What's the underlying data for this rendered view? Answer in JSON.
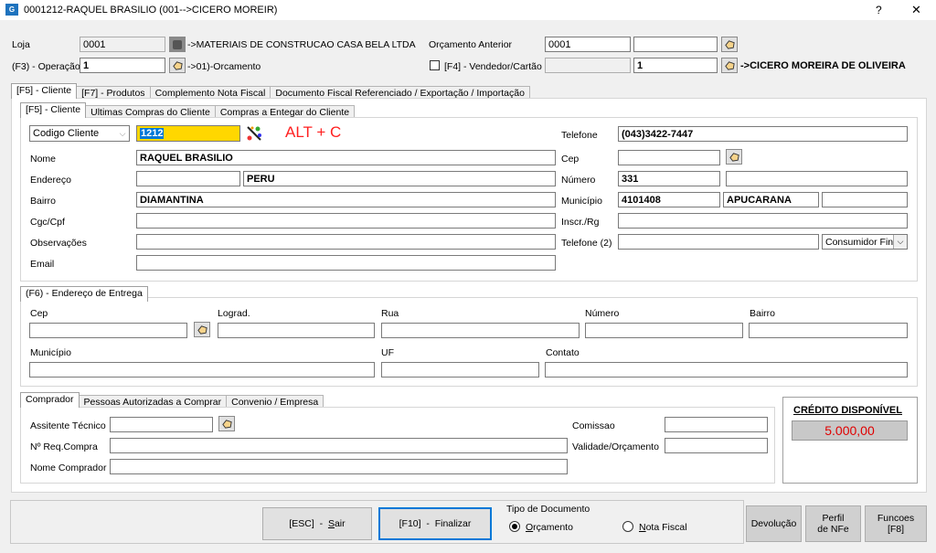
{
  "window": {
    "title": "0001212-RAQUEL BRASILIO   (001-->CICERO MOREIR)",
    "help": "?",
    "close": "✕"
  },
  "header": {
    "loja_label": "Loja",
    "loja_value": "0001",
    "loja_desc": "->MATERIAIS DE CONSTRUCAO CASA BELA LTDA",
    "operacao_label": "(F3) - Operação",
    "operacao_value": "1",
    "operacao_desc": "->01)-Orcamento",
    "orc_anterior_label": "Orçamento Anterior",
    "orc_anterior_value": "0001",
    "orc_anterior_extra": "",
    "vendedor_label": "[F4] - Vendedor/Cartão",
    "vendedor_card": "",
    "vendedor_value": "1",
    "vendedor_desc": "->CICERO MOREIRA DE OLIVEIRA"
  },
  "main_tabs": [
    "[F5] - Cliente",
    "[F7] - Produtos",
    "Complemento Nota Fiscal",
    "Documento Fiscal Referenciado / Exportação / Importação"
  ],
  "cliente_tabs": [
    "[F5] - Cliente",
    "Ultimas Compras do Cliente",
    "Compras a Entegar do Cliente"
  ],
  "cliente": {
    "search_type": "Codigo Cliente",
    "search_value": "1212",
    "hint": "ALT + C",
    "nome_label": "Nome",
    "nome": "RAQUEL BRASILIO",
    "endereco_label": "Endereço",
    "endereco_tipo": "",
    "endereco": "PERU",
    "bairro_label": "Bairro",
    "bairro": "DIAMANTINA",
    "cgc_label": "Cgc/Cpf",
    "cgc": "",
    "obs_label": "Observações",
    "obs": "",
    "email_label": "Email",
    "email": "",
    "telefone_label": "Telefone",
    "telefone": "(043)3422-7447",
    "cep_label": "Cep",
    "cep": "",
    "numero_label": "Número",
    "numero": "331",
    "complemento": "",
    "municipio_label": "Município",
    "municipio_cod": "4101408",
    "municipio": "APUCARANA",
    "uf": "",
    "inscr_label": "Inscr./Rg",
    "inscr": "",
    "telefone2_label": "Telefone (2)",
    "telefone2": "",
    "tipo_consumidor": "Consumidor Final"
  },
  "entrega_tab": "(F6) - Endereço de Entrega",
  "entrega": {
    "cep_label": "Cep",
    "lograd_label": "Lograd.",
    "rua_label": "Rua",
    "numero_label": "Número",
    "bairro_label": "Bairro",
    "municipio_label": "Município",
    "uf_label": "UF",
    "contato_label": "Contato"
  },
  "comprador_tabs": [
    "Comprador",
    "Pessoas Autorizadas a Comprar",
    "Convenio / Empresa"
  ],
  "comprador": {
    "assistente_label": "Assitente Técnico",
    "assistente": "",
    "req_label": "Nº Req.Compra",
    "req": "",
    "nome_label": "Nome Comprador",
    "nome": "",
    "comissao_label": "Comissao",
    "comissao": "",
    "validade_label": "Validade/Orçamento",
    "validade": ""
  },
  "credito": {
    "label": "CRÉDITO DISPONÍVEL",
    "value": "5.000,00"
  },
  "footer": {
    "sair_prefix": "[ESC]  -  ",
    "sair_key": "S",
    "sair_rest": "air",
    "finalizar": "[F10]  -  Finalizar",
    "tipo_doc_label": "Tipo de Documento",
    "orcamento_key": "O",
    "orcamento_rest": "rçamento",
    "nota_key": "N",
    "nota_rest": "ota Fiscal",
    "devolucao": "Devolução",
    "perfil_1": "Perfil",
    "perfil_2": "de NFe",
    "funcoes_1": "Funcoes",
    "funcoes_2": "[F8]"
  },
  "colors": {
    "highlight": "#ffd700",
    "hint": "#ff2020",
    "credit_value": "#e00000",
    "selection": "#0078d7"
  }
}
